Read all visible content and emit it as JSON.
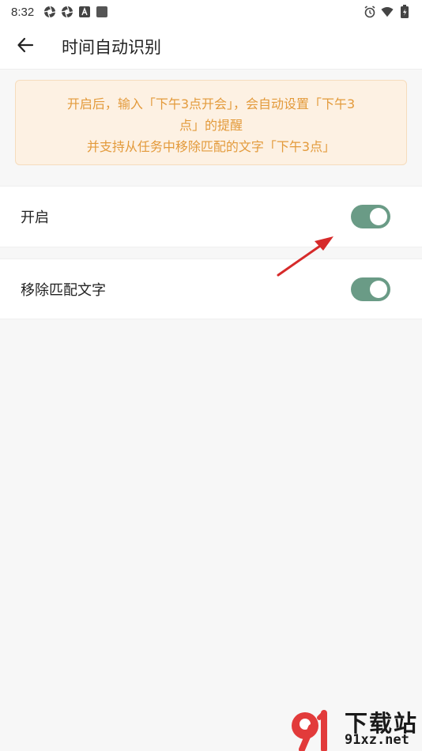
{
  "status_bar": {
    "time": "8:32",
    "left_icons": [
      "aperture-icon",
      "aperture-icon",
      "text-a-icon",
      "square-icon"
    ],
    "right_icons": [
      "alarm-icon",
      "wifi-icon",
      "battery-icon"
    ]
  },
  "app_bar": {
    "title": "时间自动识别",
    "back_icon": "arrow-left-icon"
  },
  "notice": {
    "line1": "开启后，输入「下午3点开会」，会自动设置「下午3",
    "line2": "点」的提醒",
    "line3": "并支持从任务中移除匹配的文字「下午3点」"
  },
  "settings": {
    "enable": {
      "label": "开启",
      "checked": true
    },
    "remove_text": {
      "label": "移除匹配文字",
      "checked": true
    }
  },
  "watermark": {
    "cn": "下载站",
    "url": "91xz.net"
  },
  "colors": {
    "switch_on": "#6a9b86",
    "notice_bg": "#fdf1e3",
    "notice_text": "#e39a3b",
    "arrow": "#d62a2a"
  }
}
